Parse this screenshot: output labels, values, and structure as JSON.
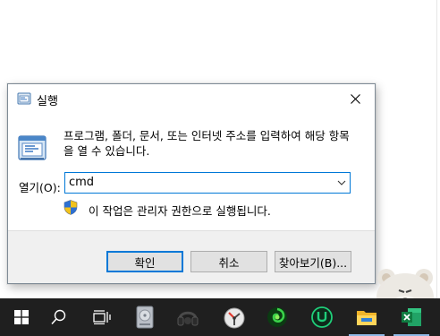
{
  "dialog": {
    "title": "실행",
    "description": "프로그램, 폴더, 문서, 또는 인터넷 주소를 입력하여 해당 항목을 열 수 있습니다.",
    "open_label": "열기(O):",
    "open_value": "cmd",
    "admin_note": "이 작업은 관리자 권한으로 실행됩니다.",
    "buttons": {
      "ok": "확인",
      "cancel": "취소",
      "browse": "찾아보기(B)..."
    }
  },
  "taskbar": {
    "items": [
      {
        "icon": "windows-start-icon"
      },
      {
        "icon": "search-icon"
      },
      {
        "icon": "task-view-icon"
      },
      {
        "icon": "disk-drive-icon"
      },
      {
        "icon": "headset-app-icon"
      },
      {
        "icon": "stopwatch-app-icon"
      },
      {
        "icon": "green-spiral-app-icon"
      },
      {
        "icon": "green-u-app-icon"
      },
      {
        "icon": "file-explorer-icon"
      },
      {
        "icon": "excel-icon"
      }
    ]
  },
  "colors": {
    "accent": "#0078d7",
    "taskbar": "#1f1f1f",
    "dialog_footer": "#f0f0f0"
  }
}
